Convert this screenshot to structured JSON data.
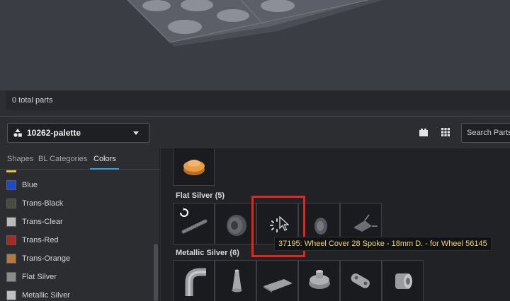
{
  "status": {
    "total_parts": "0 total parts"
  },
  "toolbar": {
    "palette_name": "10262-palette",
    "search_placeholder": "Search Parts"
  },
  "tabs": [
    {
      "label": "Shapes"
    },
    {
      "label": "BL Categories"
    },
    {
      "label": "Colors"
    }
  ],
  "colors": [
    {
      "name": "Blue",
      "swatch": "#1d4bc4"
    },
    {
      "name": "Trans-Black",
      "swatch": "#4a4a42"
    },
    {
      "name": "Trans-Clear",
      "swatch": "#b9b9b9"
    },
    {
      "name": "Trans-Red",
      "swatch": "#a82a20"
    },
    {
      "name": "Trans-Orange",
      "swatch": "#b27a3e"
    },
    {
      "name": "Flat Silver",
      "swatch": "#8b8b8b"
    },
    {
      "name": "Metallic Silver",
      "swatch": "#bfbfbf"
    }
  ],
  "sections": {
    "flat_silver": {
      "title": "Flat Silver (5)"
    },
    "metallic_silver": {
      "title": "Metallic Silver (6)"
    }
  },
  "tooltip": {
    "text": "37195: Wheel Cover 28 Spoke - 18mm D. - for Wheel 56145"
  },
  "accent": {
    "tab_underline": "#3aa0d8",
    "highlight": "#e5241e",
    "tooltip_text": "#f1d67a"
  }
}
